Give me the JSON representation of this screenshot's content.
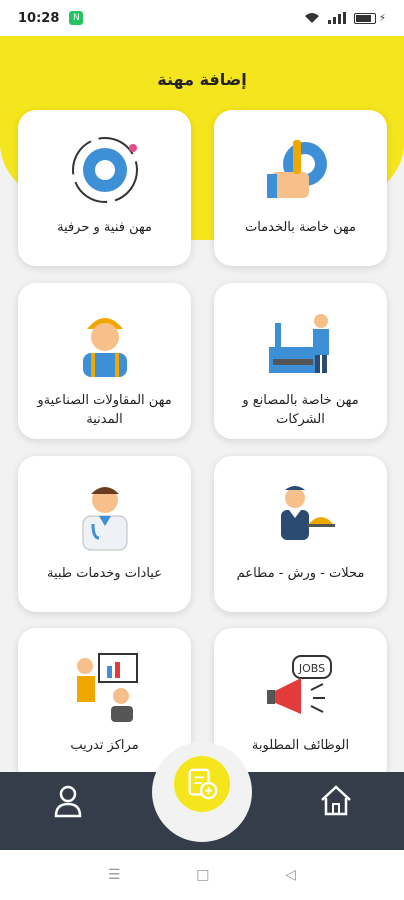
{
  "status_bar": {
    "time": "10:28",
    "badge": "N"
  },
  "header": {
    "title": "إضافة مهنة"
  },
  "cards": [
    {
      "label": "مهن خاصة بالخدمات",
      "icon": "handshake-gear-icon"
    },
    {
      "label": "مهن فنية و حرفية",
      "icon": "gear-icon"
    },
    {
      "label": "مهن خاصة بالمصانع و الشركات",
      "icon": "factory-worker-icon"
    },
    {
      "label": "مهن المقاولات الصناعيةو المدنية",
      "icon": "construction-worker-icon"
    },
    {
      "label": "محلات - ورش - مطاعم",
      "icon": "waiter-icon"
    },
    {
      "label": "عيادات وخدمات طبية",
      "icon": "doctor-icon"
    },
    {
      "label": "الوظائف المطلوبة",
      "icon": "jobs-megaphone-icon"
    },
    {
      "label": "مراكز تدريب",
      "icon": "training-presentation-icon"
    }
  ],
  "bottom_nav": {
    "left": "user-icon",
    "center": "add-document-icon",
    "right": "home-icon"
  },
  "colors": {
    "accent": "#f5e51c",
    "nav": "#353d4a"
  }
}
